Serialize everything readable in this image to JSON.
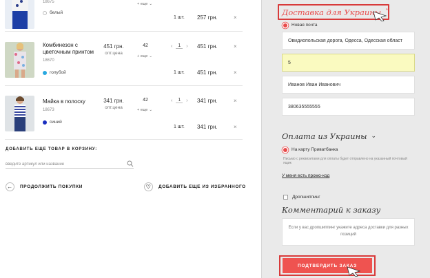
{
  "cart": {
    "items": [
      {
        "sku": "18675",
        "color": "белый",
        "color_hex": "#ffffff",
        "size_more": "+ еще",
        "qty_label": "1 шт.",
        "total": "257 грн.",
        "remove": "×"
      },
      {
        "name": "Комбинезон с цветочным принтом",
        "sku": "18670",
        "color": "голубой",
        "color_hex": "#29a8e0",
        "price": "451 грн.",
        "price_note": "опт.цена",
        "size": "42",
        "size_more": "+ еще",
        "step_minus": "‹",
        "step_value": "1",
        "step_plus": "›",
        "row_price": "451 грн.",
        "qty_label": "1 шт.",
        "total": "451 грн.",
        "remove": "×"
      },
      {
        "name": "Майка в полоску",
        "sku": "18673",
        "color": "синий",
        "color_hex": "#1a2fbf",
        "price": "341 грн.",
        "price_note": "опт.цена",
        "size": "42",
        "size_more": "+ еще",
        "step_minus": "‹",
        "step_value": "1",
        "step_plus": "›",
        "row_price": "341 грн.",
        "qty_label": "1 шт.",
        "total": "341 грн.",
        "remove": "×"
      }
    ],
    "add_title": "ДОБАВИТЬ ЕЩЕ ТОВАР В КОРЗИНУ:",
    "add_placeholder": "введите артикул или название",
    "continue_label": "ПРОДОЛЖИТЬ ПОКУПКИ",
    "favorites_label": "ДОБАВИТЬ ЕЩЕ ИЗ ИЗБРАННОГО"
  },
  "delivery": {
    "title": "Доставка для Украины",
    "accent": "#e84b4b",
    "option": "Новая почта",
    "address": "Овидиопольская дорога, Одесса, Одесская област",
    "branch": "5",
    "name": "Иванов Иван Иванович",
    "phone": "380635555555"
  },
  "payment": {
    "title": "Оплата из Украины",
    "option": "На карту Приватбанка",
    "note": "Письмо с реквизитами для оплаты будет отправлено на указанный почтовый ящик",
    "promo": "У меня есть промо-код",
    "dropship": "Дропшиппинг"
  },
  "comment": {
    "title": "Комментарий к заказу",
    "placeholder": "Если у вас дропшиппинг укажите адреса доставки для разных позиций"
  },
  "confirm_label": "ПОДТВЕРДИТЬ ЗАКАЗ",
  "icons": {
    "chevron": "⌄",
    "search": "search-icon",
    "back": "←",
    "heart": "♡"
  }
}
